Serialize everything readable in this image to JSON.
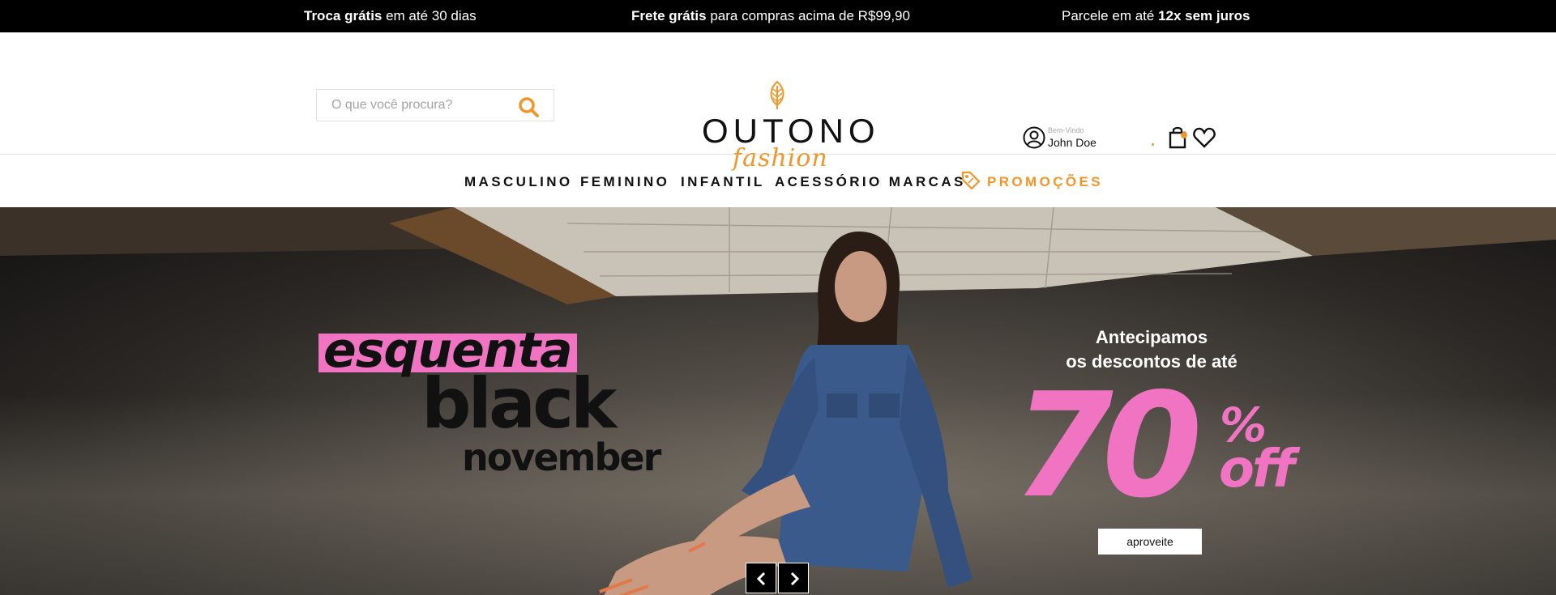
{
  "topbar": {
    "msg1_bold": "Troca grátis",
    "msg1_rest": " em até 30 dias",
    "msg2_bold": "Frete grátis",
    "msg2_rest": " para compras acima de R$99,90",
    "msg3_rest": "Parcele em até ",
    "msg3_bold": "12x sem juros"
  },
  "search": {
    "placeholder": "O que você procura?"
  },
  "logo": {
    "word": "OUTONO",
    "script": "fashion"
  },
  "user": {
    "welcome": "Bem-Vindo",
    "name": "John Doe"
  },
  "nav": {
    "items": [
      "MASCULINO",
      "FEMININO",
      "INFANTIL",
      "ACESSÓRIO",
      "MARCAS"
    ],
    "promo": "PROMOÇÕES"
  },
  "hero": {
    "line1": "esquenta",
    "line2": "black",
    "line3": "november",
    "ante1": "Antecipamos",
    "ante2": "os descontos de até",
    "value": "70",
    "percent": "%",
    "off": "off",
    "cta": "aproveite"
  },
  "colors": {
    "accent": "#f2962a",
    "pink": "#f174c3",
    "topbar": "#000000"
  },
  "icons": [
    "search-icon",
    "leaf-icon",
    "user-icon",
    "shopping-bag-icon",
    "heart-icon",
    "tag-icon",
    "chevron-left-icon",
    "chevron-right-icon"
  ]
}
